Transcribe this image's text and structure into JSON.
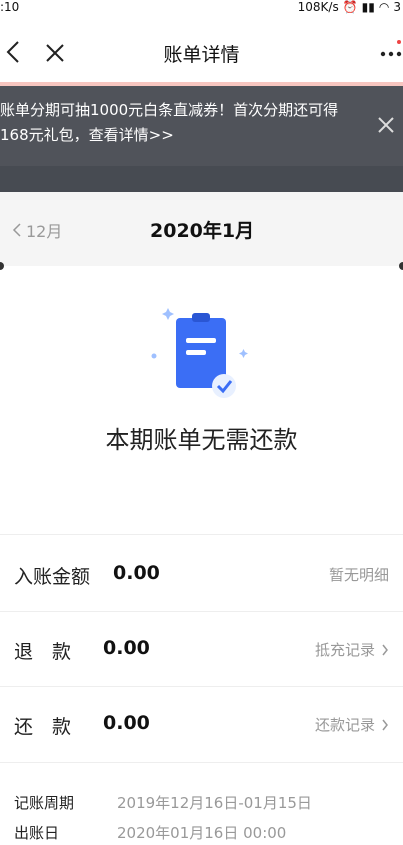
{
  "status_bar": {
    "time": ":10",
    "speed": "108K/s",
    "battery": "3"
  },
  "nav": {
    "title": "账单详情"
  },
  "banner": {
    "line1": "账单分期可抽1000元白条直减券！首次分期还可得",
    "line2": "168元礼包，查看详情>>"
  },
  "month_bar": {
    "prev_month": "12月",
    "current_month": "2020年1月"
  },
  "empty_state": {
    "text": "本期账单无需还款"
  },
  "rows": [
    {
      "label": "入账金额",
      "amount": "0.00",
      "link": "暂无明细"
    },
    {
      "label": "退　款",
      "amount": "0.00",
      "link": "抵充记录"
    },
    {
      "label": "还　款",
      "amount": "0.00",
      "link": "还款记录"
    }
  ],
  "meta": [
    {
      "key": "记账周期",
      "value": "2019年12月16日-01月15日"
    },
    {
      "key": "出账日",
      "value": "2020年01月16日 00:00"
    }
  ],
  "colors": {
    "banner_bg": "#50535a",
    "accent_blue": "#3b6ef5",
    "nav_line": "#f7c6c0"
  }
}
